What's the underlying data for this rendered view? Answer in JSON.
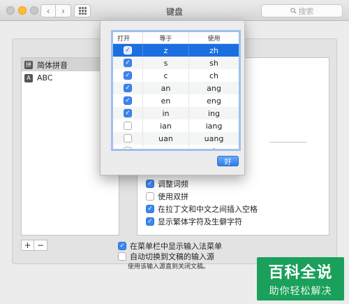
{
  "window": {
    "title": "键盘",
    "search_placeholder": "搜索"
  },
  "nav": {
    "back_glyph": "‹",
    "forward_glyph": "›"
  },
  "sources": [
    {
      "icon_text": "拼",
      "label": "简体拼音"
    },
    {
      "icon_text": "A",
      "label": "ABC"
    }
  ],
  "fuzzy_dialog": {
    "headers": {
      "enable": "打开",
      "equals": "等于",
      "use": "使用"
    },
    "rows": [
      {
        "checked": true,
        "equals": "z",
        "use": "zh"
      },
      {
        "checked": true,
        "equals": "s",
        "use": "sh"
      },
      {
        "checked": true,
        "equals": "c",
        "use": "ch"
      },
      {
        "checked": true,
        "equals": "an",
        "use": "ang"
      },
      {
        "checked": true,
        "equals": "en",
        "use": "eng"
      },
      {
        "checked": true,
        "equals": "in",
        "use": "ing"
      },
      {
        "checked": false,
        "equals": "ian",
        "use": "iang"
      },
      {
        "checked": false,
        "equals": "uan",
        "use": "uang"
      },
      {
        "checked": false,
        "equals": "n",
        "use": "l"
      }
    ],
    "ok_label": "好"
  },
  "options": {
    "adjust_freq": "调整词频",
    "double_pinyin": "使用双拼",
    "insert_space": "在拉丁文和中文之间插入空格",
    "show_traditional": "显示繁体字符及生僻字符"
  },
  "controls": {
    "plus": "+",
    "minus": "−"
  },
  "menu_options": {
    "show_in_menubar": "在菜单栏中显示输入法菜单",
    "auto_switch": "自动切换到文稿的输入源",
    "auto_switch_hint": "使用该输入源直到关闭文稿。"
  },
  "watermark": {
    "line1": "百科全说",
    "line2": "助你轻松解决"
  },
  "colors": {
    "accent": "#1b6fe0",
    "checkbox_on": "#3b86f0",
    "watermark_bg": "#1aa05a"
  }
}
